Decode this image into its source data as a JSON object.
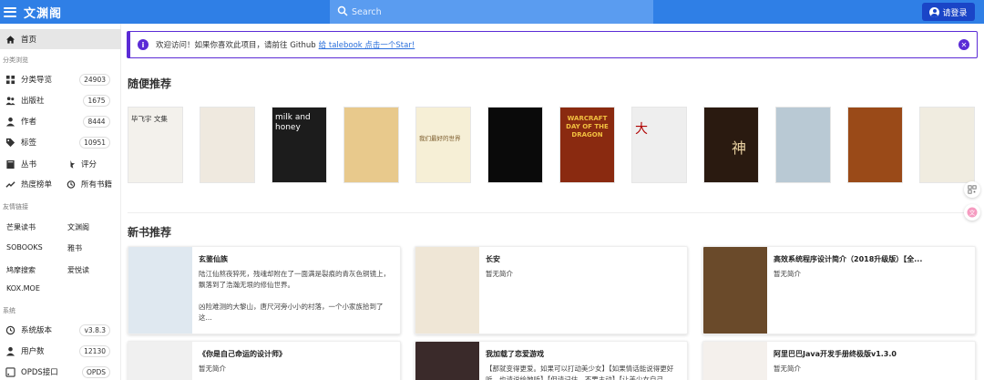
{
  "app": {
    "title": "文渊阁"
  },
  "search": {
    "placeholder": "Search"
  },
  "login": {
    "label": "请登录"
  },
  "sidebar": {
    "home": "首页",
    "section_browse": "分类浏览",
    "browse": [
      {
        "label": "分类导览",
        "count": "24903",
        "icon": "grid-icon"
      },
      {
        "label": "出版社",
        "count": "1675",
        "icon": "people-icon"
      },
      {
        "label": "作者",
        "count": "8444",
        "icon": "person-icon"
      },
      {
        "label": "标签",
        "count": "10951",
        "icon": "tag-icon"
      }
    ],
    "shelf": {
      "label": "丛书",
      "icon": "book-icon"
    },
    "rating": {
      "label": "评分",
      "icon": "star-half-icon"
    },
    "hot": {
      "label": "热度榜单",
      "icon": "trending-icon"
    },
    "all_books": {
      "label": "所有书籍",
      "icon": "history-icon"
    },
    "section_links": "友情链接",
    "links": [
      "芒果读书",
      "文渊阁",
      "SOBOOKS",
      "雅书",
      "鸠摩搜索",
      "爱悦读",
      "KOX.MOE"
    ],
    "section_system": "系统",
    "system": [
      {
        "label": "系统版本",
        "count": "v3.8.3",
        "icon": "clock-icon"
      },
      {
        "label": "用户数",
        "count": "12130",
        "icon": "user-icon"
      },
      {
        "label": "OPDS接口",
        "count": "OPDS",
        "icon": "rss-icon"
      }
    ]
  },
  "notice": {
    "text": "欢迎访问！如果你喜欢此项目，请前往 Github",
    "link": "给 talebook 点击一个Star!"
  },
  "random": {
    "title": "随便推荐",
    "covers": [
      {
        "title": "毕飞宇 文集",
        "bg": "#f3f1ec",
        "fg": "#333"
      },
      {
        "title": "",
        "bg": "#efe9df",
        "fg": "#444"
      },
      {
        "title": "milk and honey",
        "bg": "#1c1c1c",
        "fg": "#ffffff"
      },
      {
        "title": "",
        "bg": "#e8c98c",
        "fg": "#5a3a10"
      },
      {
        "title": "我们最好的世界",
        "bg": "#f6efd6",
        "fg": "#7a5a2a"
      },
      {
        "title": "",
        "bg": "#0a0a0a",
        "fg": "#cccccc"
      },
      {
        "title": "WARCRAFT DAY OF THE DRAGON",
        "bg": "#8a2a10",
        "fg": "#f2c040"
      },
      {
        "title": "大",
        "bg": "#eeeeee",
        "fg": "#b00000"
      },
      {
        "title": "神",
        "bg": "#2a1a10",
        "fg": "#e8d0a0"
      },
      {
        "title": "",
        "bg": "#b9c9d4",
        "fg": "#333"
      },
      {
        "title": "",
        "bg": "#9a4a18",
        "fg": "#f4d070"
      },
      {
        "title": "",
        "bg": "#f0ece0",
        "fg": "#555"
      }
    ]
  },
  "newbooks": {
    "title": "新书推荐",
    "cards": [
      {
        "title": "玄鉴仙族",
        "desc": "陆江仙熬夜猝死，残魂却附在了一面满是裂痕的青灰色铜镜上，飘落到了浩瀚无垠的修仙世界。\n\n凶险难测的大黎山，唐尺河旁小小的村落，一个小家族拾到了这...",
        "bg": "#dfe8f0"
      },
      {
        "title": "长安",
        "desc": "暂无简介",
        "bg": "#efe6d6"
      },
      {
        "title": "高效系统程序设计简介（2018升级版）【全...",
        "desc": "暂无简介",
        "bg": "#6a4a2a"
      },
      {
        "title": "《你是自己命运的设计师》",
        "desc": "暂无简介",
        "bg": "#f0f0f0"
      },
      {
        "title": "我加载了恋爱游戏",
        "desc": "【那就变得更爱。如果可以打动美少女】【如果情话能说得更好听，也请说给她听】【但请记住，不要主动】【让美少女自己",
        "bg": "#3a2a2a"
      },
      {
        "title": "阿里巴巴Java开发手册终极版v1.3.0",
        "desc": "暂无简介",
        "bg": "#f4f0ec"
      }
    ]
  }
}
